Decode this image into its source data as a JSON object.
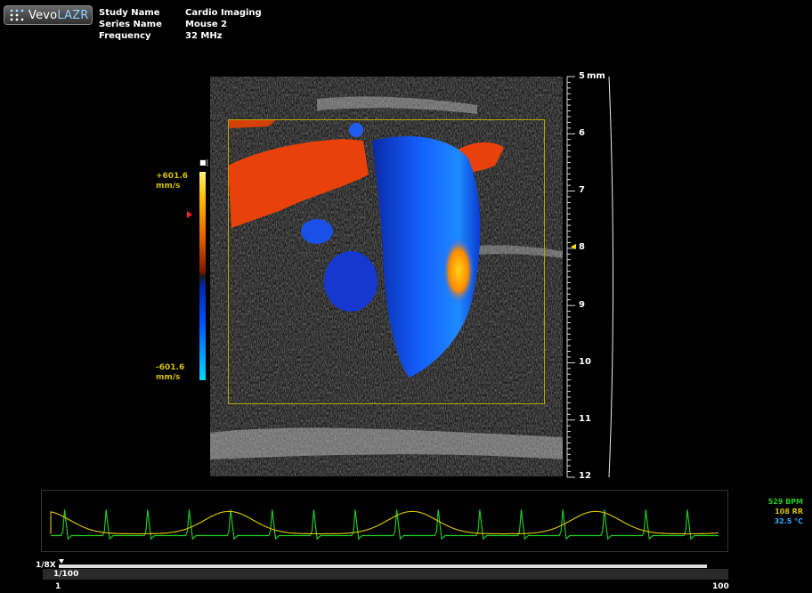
{
  "app": {
    "logo_prefix": "Vevo",
    "logo_suffix": "LAZR",
    "logo_icon": "vevo-dots-icon"
  },
  "study": {
    "rows": [
      {
        "label": "Study Name",
        "value": "Cardio Imaging"
      },
      {
        "label": "Series Name",
        "value": "Mouse 2"
      },
      {
        "label": "Frequency",
        "value": "32 MHz"
      }
    ]
  },
  "velocity_scale": {
    "max_value": "+601.6",
    "max_unit": "mm/s",
    "min_value": "-601.6",
    "min_unit": "mm/s"
  },
  "depth_ruler": {
    "unit": "mm",
    "labels": [
      "5",
      "6",
      "7",
      "8",
      "9",
      "10",
      "11",
      "12"
    ],
    "focus_depth_mm": 8
  },
  "physio": {
    "heart_rate": "529 BPM",
    "resp_rate": "108 RR",
    "temperature": "32.5 °C",
    "colors": {
      "heart_rate": "#22cc22",
      "resp_rate": "#d8c000",
      "temperature": "#33aaff"
    }
  },
  "playback": {
    "speed": "1/8X",
    "frame": "1/100",
    "range_start": "1",
    "range_end": "100"
  },
  "colors": {
    "roi_border": "#b5a600",
    "ecg_trace": "#22cc22",
    "resp_trace": "#d8c000"
  }
}
